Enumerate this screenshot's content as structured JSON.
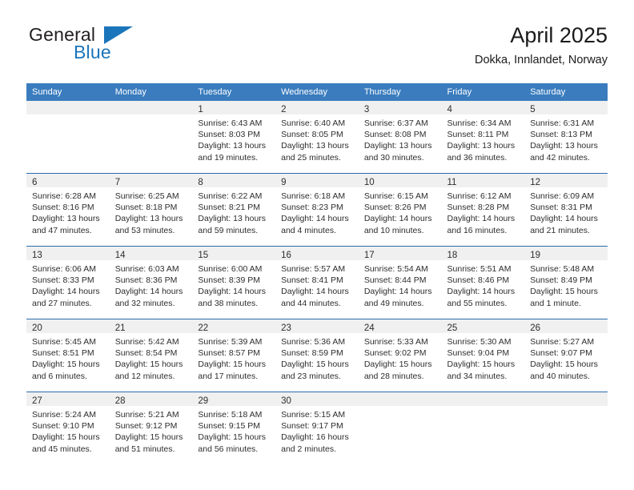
{
  "brand": {
    "name_part1": "General",
    "name_part2": "Blue",
    "triangle_color": "#1b75bb"
  },
  "header": {
    "title": "April 2025",
    "subtitle": "Dokka, Innlandet, Norway"
  },
  "theme": {
    "header_row_bg": "#3a7cbe",
    "row_separator": "#2b6cb0",
    "date_band_bg": "#f0f0f0",
    "text": "#2d2d2d"
  },
  "weekday_headers": [
    "Sunday",
    "Monday",
    "Tuesday",
    "Wednesday",
    "Thursday",
    "Friday",
    "Saturday"
  ],
  "weeks": [
    [
      {
        "empty": true
      },
      {
        "empty": true
      },
      {
        "date": "1",
        "sunrise": "Sunrise: 6:43 AM",
        "sunset": "Sunset: 8:03 PM",
        "daylight": "Daylight: 13 hours and 19 minutes."
      },
      {
        "date": "2",
        "sunrise": "Sunrise: 6:40 AM",
        "sunset": "Sunset: 8:05 PM",
        "daylight": "Daylight: 13 hours and 25 minutes."
      },
      {
        "date": "3",
        "sunrise": "Sunrise: 6:37 AM",
        "sunset": "Sunset: 8:08 PM",
        "daylight": "Daylight: 13 hours and 30 minutes."
      },
      {
        "date": "4",
        "sunrise": "Sunrise: 6:34 AM",
        "sunset": "Sunset: 8:11 PM",
        "daylight": "Daylight: 13 hours and 36 minutes."
      },
      {
        "date": "5",
        "sunrise": "Sunrise: 6:31 AM",
        "sunset": "Sunset: 8:13 PM",
        "daylight": "Daylight: 13 hours and 42 minutes."
      }
    ],
    [
      {
        "date": "6",
        "sunrise": "Sunrise: 6:28 AM",
        "sunset": "Sunset: 8:16 PM",
        "daylight": "Daylight: 13 hours and 47 minutes."
      },
      {
        "date": "7",
        "sunrise": "Sunrise: 6:25 AM",
        "sunset": "Sunset: 8:18 PM",
        "daylight": "Daylight: 13 hours and 53 minutes."
      },
      {
        "date": "8",
        "sunrise": "Sunrise: 6:22 AM",
        "sunset": "Sunset: 8:21 PM",
        "daylight": "Daylight: 13 hours and 59 minutes."
      },
      {
        "date": "9",
        "sunrise": "Sunrise: 6:18 AM",
        "sunset": "Sunset: 8:23 PM",
        "daylight": "Daylight: 14 hours and 4 minutes."
      },
      {
        "date": "10",
        "sunrise": "Sunrise: 6:15 AM",
        "sunset": "Sunset: 8:26 PM",
        "daylight": "Daylight: 14 hours and 10 minutes."
      },
      {
        "date": "11",
        "sunrise": "Sunrise: 6:12 AM",
        "sunset": "Sunset: 8:28 PM",
        "daylight": "Daylight: 14 hours and 16 minutes."
      },
      {
        "date": "12",
        "sunrise": "Sunrise: 6:09 AM",
        "sunset": "Sunset: 8:31 PM",
        "daylight": "Daylight: 14 hours and 21 minutes."
      }
    ],
    [
      {
        "date": "13",
        "sunrise": "Sunrise: 6:06 AM",
        "sunset": "Sunset: 8:33 PM",
        "daylight": "Daylight: 14 hours and 27 minutes."
      },
      {
        "date": "14",
        "sunrise": "Sunrise: 6:03 AM",
        "sunset": "Sunset: 8:36 PM",
        "daylight": "Daylight: 14 hours and 32 minutes."
      },
      {
        "date": "15",
        "sunrise": "Sunrise: 6:00 AM",
        "sunset": "Sunset: 8:39 PM",
        "daylight": "Daylight: 14 hours and 38 minutes."
      },
      {
        "date": "16",
        "sunrise": "Sunrise: 5:57 AM",
        "sunset": "Sunset: 8:41 PM",
        "daylight": "Daylight: 14 hours and 44 minutes."
      },
      {
        "date": "17",
        "sunrise": "Sunrise: 5:54 AM",
        "sunset": "Sunset: 8:44 PM",
        "daylight": "Daylight: 14 hours and 49 minutes."
      },
      {
        "date": "18",
        "sunrise": "Sunrise: 5:51 AM",
        "sunset": "Sunset: 8:46 PM",
        "daylight": "Daylight: 14 hours and 55 minutes."
      },
      {
        "date": "19",
        "sunrise": "Sunrise: 5:48 AM",
        "sunset": "Sunset: 8:49 PM",
        "daylight": "Daylight: 15 hours and 1 minute."
      }
    ],
    [
      {
        "date": "20",
        "sunrise": "Sunrise: 5:45 AM",
        "sunset": "Sunset: 8:51 PM",
        "daylight": "Daylight: 15 hours and 6 minutes."
      },
      {
        "date": "21",
        "sunrise": "Sunrise: 5:42 AM",
        "sunset": "Sunset: 8:54 PM",
        "daylight": "Daylight: 15 hours and 12 minutes."
      },
      {
        "date": "22",
        "sunrise": "Sunrise: 5:39 AM",
        "sunset": "Sunset: 8:57 PM",
        "daylight": "Daylight: 15 hours and 17 minutes."
      },
      {
        "date": "23",
        "sunrise": "Sunrise: 5:36 AM",
        "sunset": "Sunset: 8:59 PM",
        "daylight": "Daylight: 15 hours and 23 minutes."
      },
      {
        "date": "24",
        "sunrise": "Sunrise: 5:33 AM",
        "sunset": "Sunset: 9:02 PM",
        "daylight": "Daylight: 15 hours and 28 minutes."
      },
      {
        "date": "25",
        "sunrise": "Sunrise: 5:30 AM",
        "sunset": "Sunset: 9:04 PM",
        "daylight": "Daylight: 15 hours and 34 minutes."
      },
      {
        "date": "26",
        "sunrise": "Sunrise: 5:27 AM",
        "sunset": "Sunset: 9:07 PM",
        "daylight": "Daylight: 15 hours and 40 minutes."
      }
    ],
    [
      {
        "date": "27",
        "sunrise": "Sunrise: 5:24 AM",
        "sunset": "Sunset: 9:10 PM",
        "daylight": "Daylight: 15 hours and 45 minutes."
      },
      {
        "date": "28",
        "sunrise": "Sunrise: 5:21 AM",
        "sunset": "Sunset: 9:12 PM",
        "daylight": "Daylight: 15 hours and 51 minutes."
      },
      {
        "date": "29",
        "sunrise": "Sunrise: 5:18 AM",
        "sunset": "Sunset: 9:15 PM",
        "daylight": "Daylight: 15 hours and 56 minutes."
      },
      {
        "date": "30",
        "sunrise": "Sunrise: 5:15 AM",
        "sunset": "Sunset: 9:17 PM",
        "daylight": "Daylight: 16 hours and 2 minutes."
      },
      {
        "empty": true
      },
      {
        "empty": true
      },
      {
        "empty": true
      }
    ]
  ]
}
